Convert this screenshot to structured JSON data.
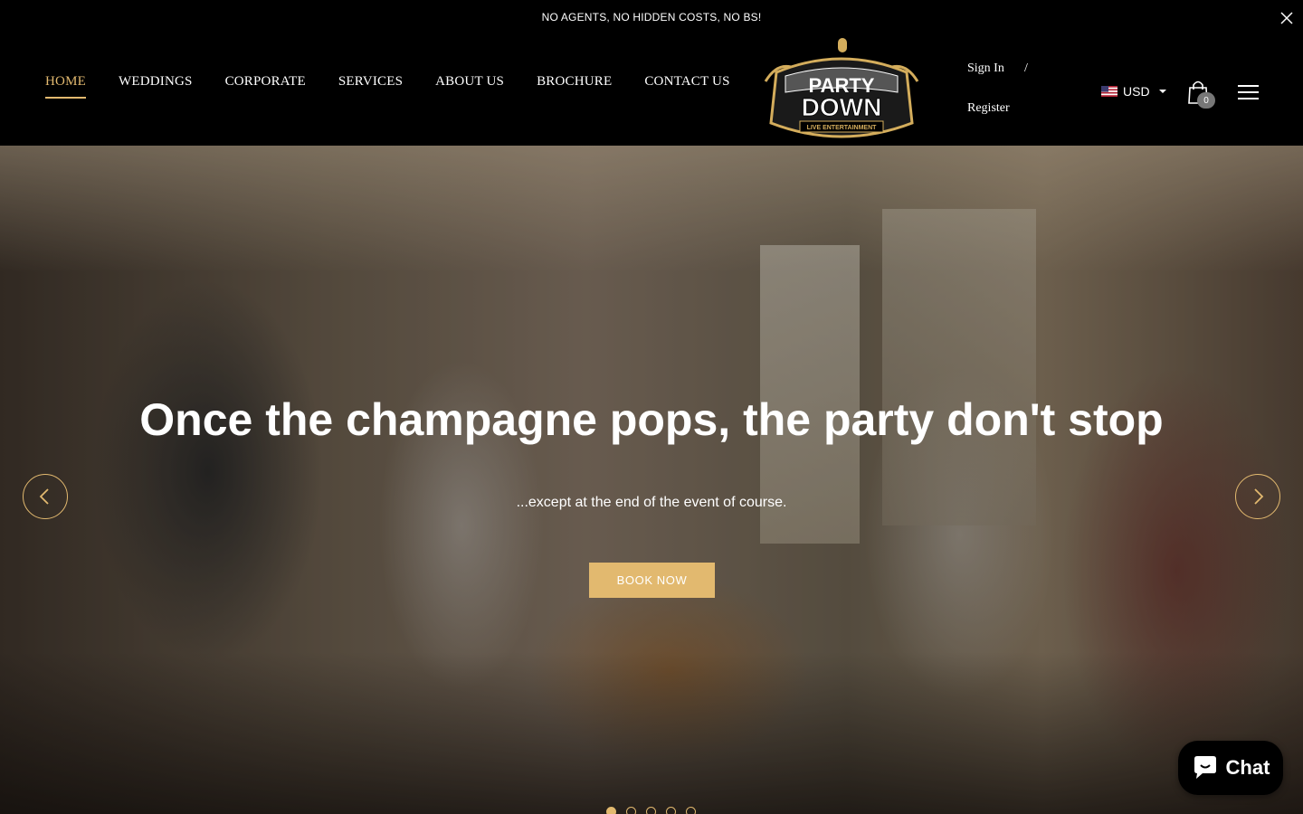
{
  "announcement": {
    "text": "NO AGENTS, NO HIDDEN COSTS, NO BS!"
  },
  "nav": {
    "items": [
      {
        "label": "HOME",
        "active": true
      },
      {
        "label": "WEDDINGS"
      },
      {
        "label": "CORPORATE"
      },
      {
        "label": "SERVICES"
      },
      {
        "label": "ABOUT US"
      },
      {
        "label": "BROCHURE"
      },
      {
        "label": "CONTACT US"
      }
    ]
  },
  "logo": {
    "line1": "PARTY",
    "line2": "DOWN",
    "tagline": "LIVE ENTERTAINMENT"
  },
  "account": {
    "sign_in": "Sign In",
    "separator": "/",
    "register": "Register"
  },
  "currency": {
    "selected": "USD",
    "flag_icon": "us-flag-icon"
  },
  "cart": {
    "count": "0"
  },
  "hero": {
    "title": "Once the champagne pops, the party don't stop",
    "subtitle": "...except at the end of the event of course.",
    "button": "BOOK NOW",
    "slide_count": 5,
    "active_slide": 1
  },
  "chat": {
    "label": "Chat"
  },
  "colors": {
    "accent": "#e2b96f",
    "background": "#000000"
  }
}
